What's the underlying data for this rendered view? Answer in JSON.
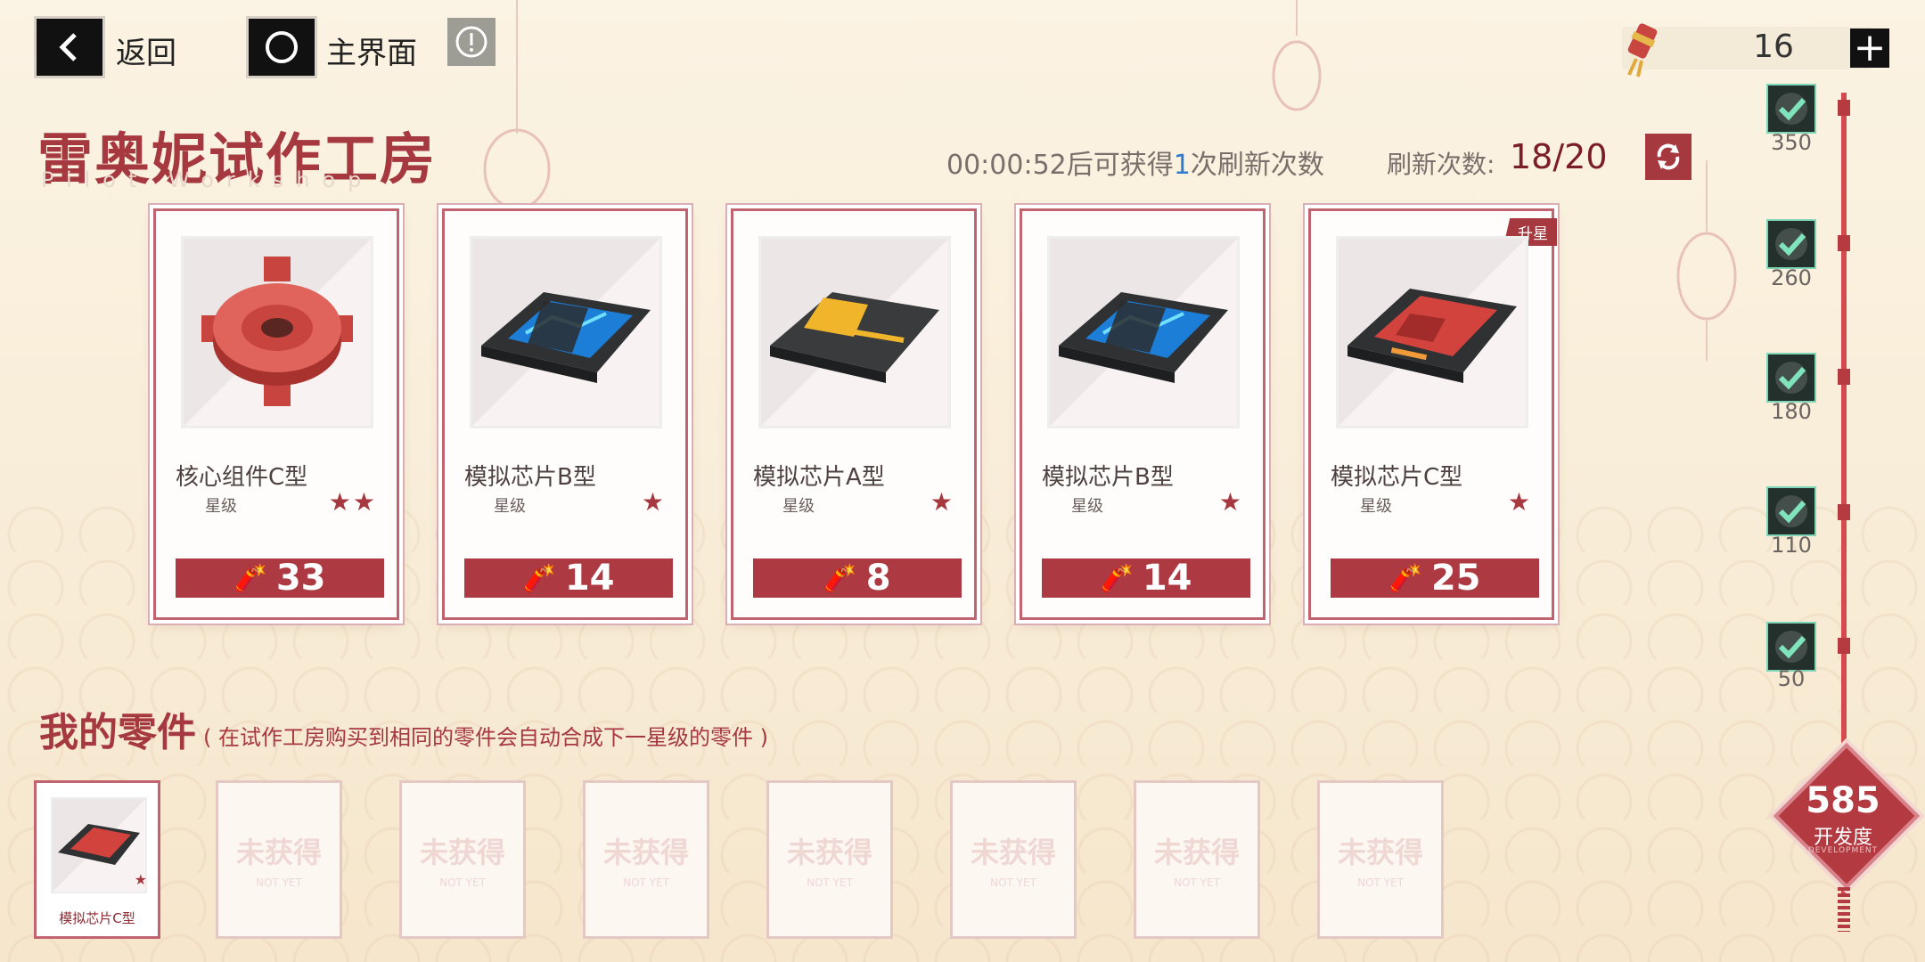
{
  "topbar": {
    "back_label": "返回",
    "home_label": "主界面",
    "currency_amount": "16"
  },
  "header": {
    "title": "雷奥妮试作工房",
    "subtitle_en": "Pilot Workshop",
    "timer_time": "00:00:52",
    "timer_mid": "后可获得",
    "timer_count": "1",
    "timer_suffix": "次刷新次数",
    "refresh_label": "刷新次数:",
    "refresh_count": "18/20"
  },
  "shop": {
    "items": [
      {
        "name": "核心组件C型",
        "star_label": "星级",
        "stars": "★★",
        "price": "33",
        "badge": ""
      },
      {
        "name": "模拟芯片B型",
        "star_label": "星级",
        "stars": "★",
        "price": "14",
        "badge": ""
      },
      {
        "name": "模拟芯片A型",
        "star_label": "星级",
        "stars": "★",
        "price": "8",
        "badge": ""
      },
      {
        "name": "模拟芯片B型",
        "star_label": "星级",
        "stars": "★",
        "price": "14",
        "badge": ""
      },
      {
        "name": "模拟芯片C型",
        "star_label": "星级",
        "stars": "★",
        "price": "25",
        "badge": "升星"
      }
    ]
  },
  "my_parts": {
    "title": "我的零件",
    "note": "( 在试作工房购买到相同的零件会自动合成下一星级的零件 )",
    "owned": {
      "name": "模拟芯片C型",
      "stars": "★"
    },
    "empty_label": "未获得",
    "empty_label_en": "NOT YET"
  },
  "progress": {
    "milestones": [
      "350",
      "260",
      "180",
      "110",
      "50"
    ],
    "development_value": "585",
    "development_label": "开发度",
    "development_en": "DEVELOPMENT"
  },
  "colors": {
    "accent": "#a6383f",
    "background": "#fbf3e3",
    "check": "#7fd6b6"
  }
}
